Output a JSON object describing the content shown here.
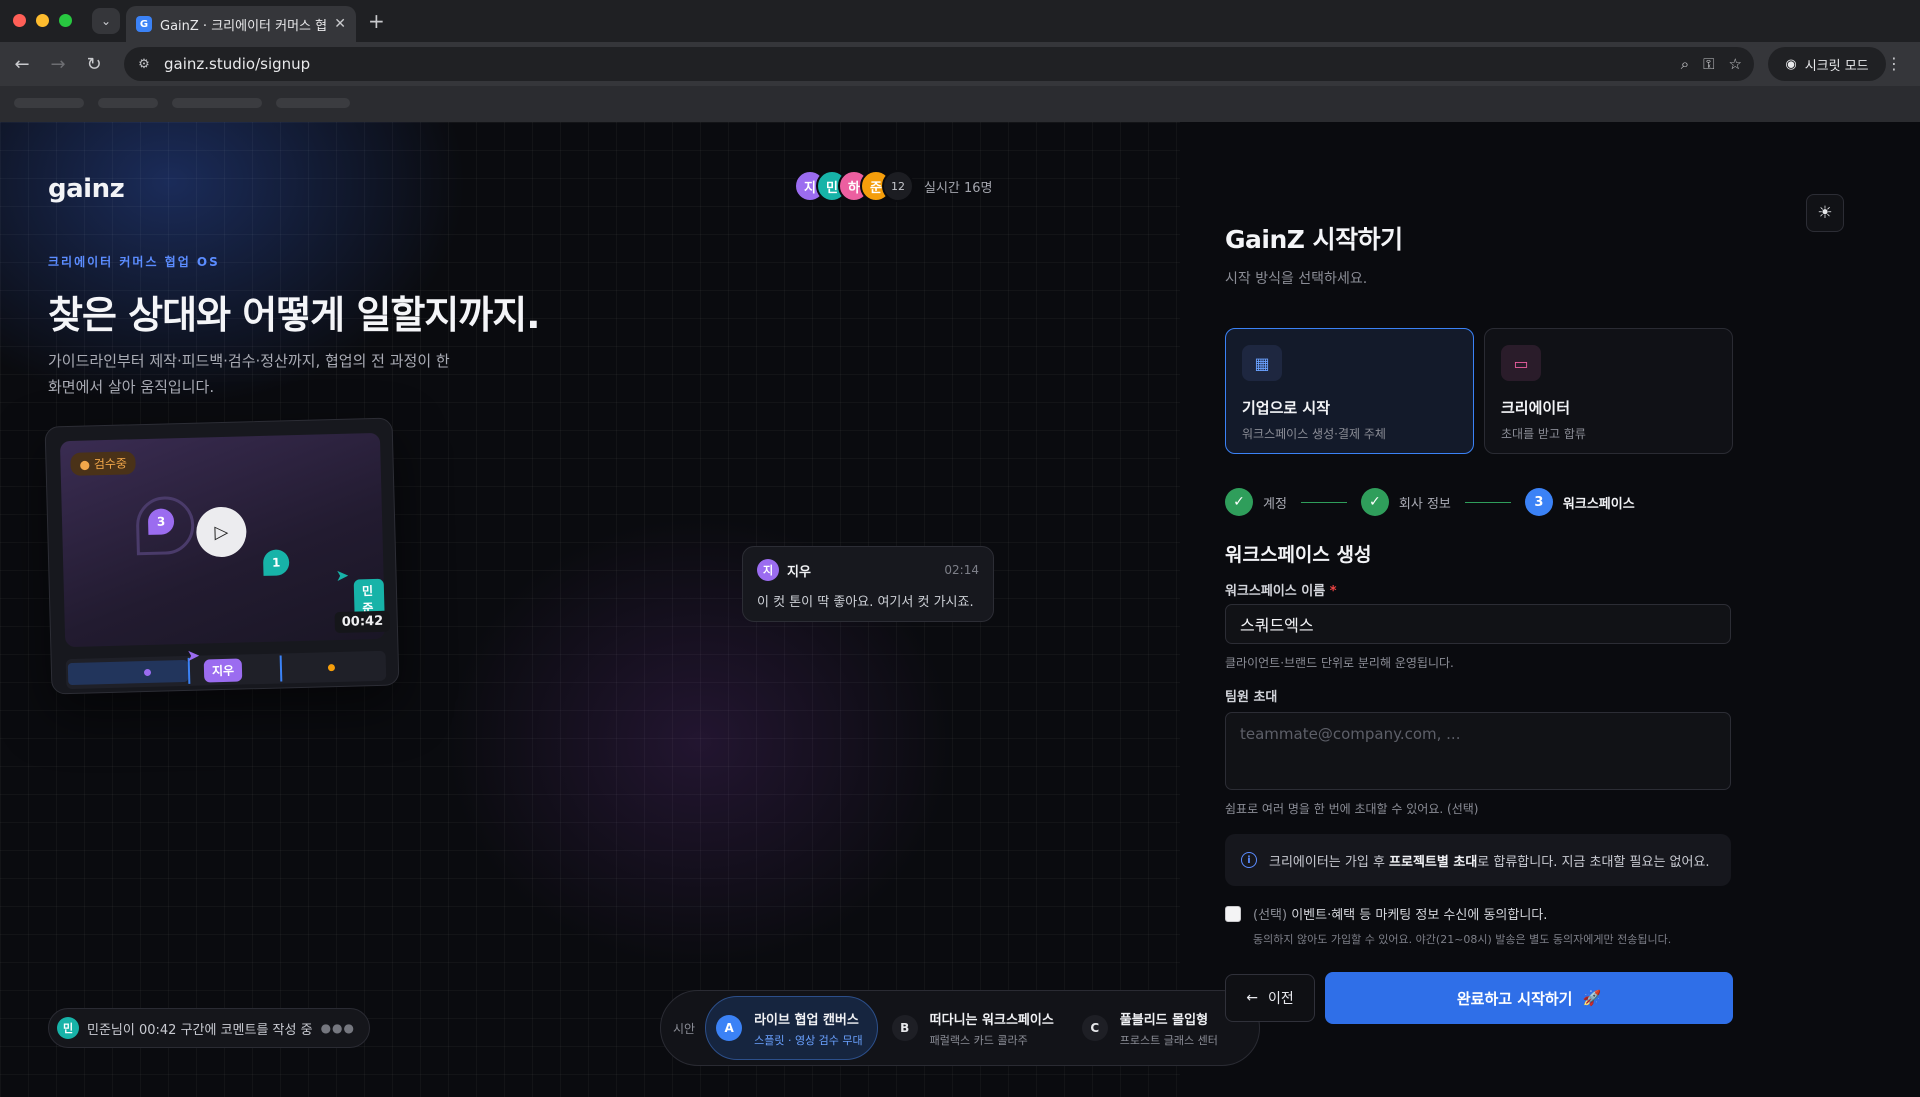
{
  "browser": {
    "tab_title": "GainZ · 크리에이터 커머스 협업 OS",
    "tab_favicon": "G",
    "url": "gainz.studio/signup",
    "incognito_label": "시크릿 모드"
  },
  "left": {
    "logo": "gainz",
    "presence": {
      "avatars": [
        {
          "initial": "지",
          "color": "#9b6cf0"
        },
        {
          "initial": "민",
          "color": "#17b3a8"
        },
        {
          "initial": "하",
          "color": "#ec5fa0"
        },
        {
          "initial": "준",
          "color": "#f59e0b"
        }
      ],
      "count": "12",
      "text": "실시간 16명"
    },
    "eyebrow": "크리에이터 커머스 협업 OS",
    "title": "찾은 상대와 어떻게 일할지까지.",
    "subtitle": "가이드라인부터 제작·피드백·검수·정산까지, 협업의 전 과정이 한 화면에서 살아 움직입니다.",
    "player": {
      "status_badge": "검수중",
      "pin_1": "3",
      "pin_2": "1",
      "cursor_tag_1": "민준",
      "timecode": "00:42",
      "cursor_tag_2": "지우"
    },
    "comment": {
      "avatar": "지",
      "author": "지우",
      "time": "02:14",
      "text": "이 컷 톤이 딱 좋아요. 여기서 컷 가시죠."
    },
    "typing": {
      "avatar": "민",
      "text": "민준님이 00:42 구간에 코멘트를 작성 중"
    },
    "variants": {
      "label": "시안",
      "items": [
        {
          "letter": "A",
          "title": "라이브 협업 캔버스",
          "sub": "스플릿 · 영상 검수 무대"
        },
        {
          "letter": "B",
          "title": "떠다니는 워크스페이스",
          "sub": "패럴랙스 카드 콜라주"
        },
        {
          "letter": "C",
          "title": "풀블리드 몰입형",
          "sub": "프로스트 글래스 센터"
        }
      ]
    }
  },
  "form": {
    "title": "GainZ 시작하기",
    "subtitle": "시작 방식을 선택하세요.",
    "roles": [
      {
        "title": "기업으로 시작",
        "sub": "워크스페이스 생성·결제 주체",
        "icon": "building-icon"
      },
      {
        "title": "크리에이터",
        "sub": "초대를 받고 합류",
        "icon": "video-camera-icon"
      }
    ],
    "steps": [
      {
        "label": "계정",
        "state": "done"
      },
      {
        "label": "회사 정보",
        "state": "done"
      },
      {
        "label": "워크스페이스",
        "state": "current",
        "number": "3"
      }
    ],
    "section_title": "워크스페이스 생성",
    "workspace_label": "워크스페이스 이름",
    "workspace_required": "*",
    "workspace_value": "스쿼드엑스",
    "workspace_hint": "클라이언트·브랜드 단위로 분리해 운영됩니다.",
    "invite_label": "팀원 초대",
    "invite_placeholder": "teammate@company.com, ...",
    "invite_hint": "쉼표로 여러 명을 한 번에 초대할 수 있어요. (선택)",
    "info_pre": "크리에이터는 가입 후 ",
    "info_bold": "프로젝트별 초대",
    "info_post": "로 합류합니다. 지금 초대할 필요는 없어요.",
    "consent_optional": "(선택)",
    "consent_main": " 이벤트·혜택 등 마케팅 정보 수신에 동의합니다.",
    "consent_sub": "동의하지 않아도 가입할 수 있어요. 야간(21~08시) 발송은 별도 동의자에게만 전송됩니다.",
    "prev_label": "이전",
    "submit_label": "완료하고 시작하기"
  }
}
